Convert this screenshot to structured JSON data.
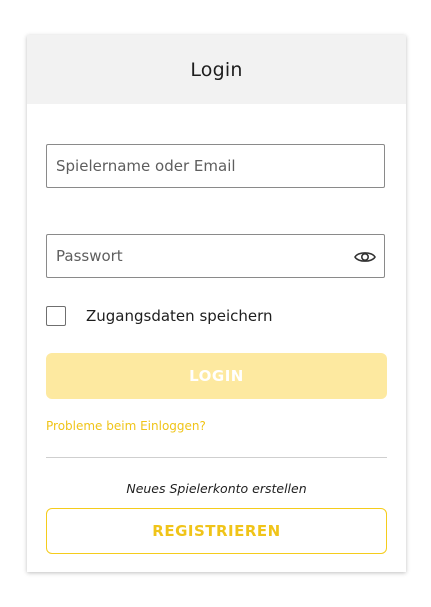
{
  "header": {
    "title": "Login"
  },
  "form": {
    "username": {
      "placeholder": "Spielername oder Email",
      "value": ""
    },
    "password": {
      "placeholder": "Passwort",
      "value": "",
      "toggle_icon": "eye-icon"
    },
    "remember": {
      "label": "Zugangsdaten speichern",
      "checked": false
    },
    "login_button_label": "LOGIN",
    "forgot_link": "Probleme beim Einloggen?"
  },
  "register": {
    "text": "Neues Spielerkonto erstellen",
    "button_label": "REGISTRIEREN"
  },
  "colors": {
    "accent": "#f0c419",
    "login_button_disabled": "#fde9a0",
    "header_bg": "#f2f2f2"
  }
}
